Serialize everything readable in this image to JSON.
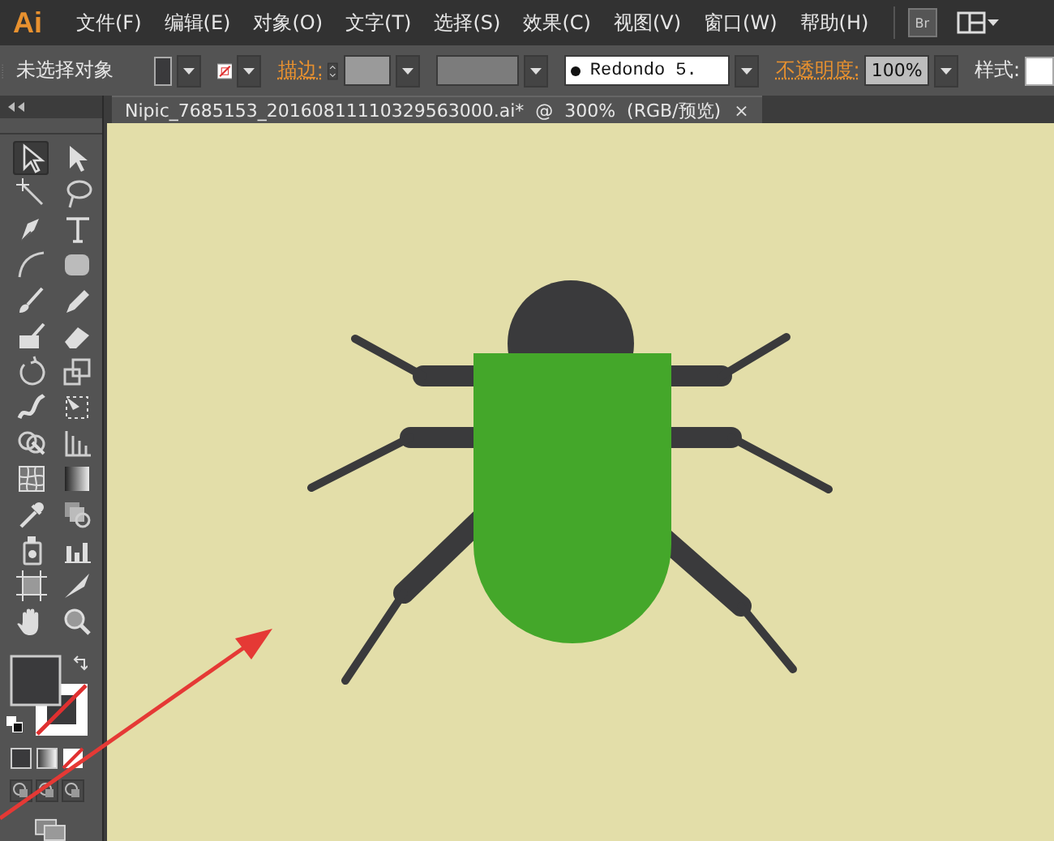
{
  "app": {
    "logo": "Ai"
  },
  "menu": [
    {
      "label": "文件(F)"
    },
    {
      "label": "编辑(E)"
    },
    {
      "label": "对象(O)"
    },
    {
      "label": "文字(T)"
    },
    {
      "label": "选择(S)"
    },
    {
      "label": "效果(C)"
    },
    {
      "label": "视图(V)"
    },
    {
      "label": "窗口(W)"
    },
    {
      "label": "帮助(H)"
    }
  ],
  "bridge_button": {
    "label": "Br"
  },
  "control_bar": {
    "selection_label": "未选择对象",
    "stroke_label": "描边:",
    "brush": "Redondo 5.",
    "opacity_label": "不透明度:",
    "opacity": "100%",
    "style_label": "样式:"
  },
  "document_tab": {
    "title": "Nipic_7685153_20160811110329563000.ai*  @  300%  (RGB/预览)",
    "close": "×"
  },
  "tools": [
    {
      "kind": "selection",
      "selected": true
    },
    {
      "kind": "direct-selection",
      "selected": false
    },
    {
      "kind": "magic-wand",
      "selected": false
    },
    {
      "kind": "lasso",
      "selected": false
    },
    {
      "kind": "pen",
      "selected": false
    },
    {
      "kind": "type",
      "selected": false
    },
    {
      "kind": "arc",
      "selected": false
    },
    {
      "kind": "rounded-rect",
      "selected": false
    },
    {
      "kind": "paintbrush",
      "selected": false
    },
    {
      "kind": "pencil",
      "selected": false
    },
    {
      "kind": "blob-brush",
      "selected": false
    },
    {
      "kind": "eraser",
      "selected": false
    },
    {
      "kind": "rotate",
      "selected": false
    },
    {
      "kind": "scale",
      "selected": false
    },
    {
      "kind": "warp",
      "selected": false
    },
    {
      "kind": "free-transform",
      "selected": false
    },
    {
      "kind": "shape-builder",
      "selected": false
    },
    {
      "kind": "graph",
      "selected": false
    },
    {
      "kind": "mesh",
      "selected": false
    },
    {
      "kind": "gradient",
      "selected": false
    },
    {
      "kind": "eyedropper",
      "selected": false
    },
    {
      "kind": "blend",
      "selected": false
    },
    {
      "kind": "symbol-sprayer",
      "selected": false
    },
    {
      "kind": "column-graph",
      "selected": false
    },
    {
      "kind": "artboard",
      "selected": false
    },
    {
      "kind": "slice",
      "selected": false
    },
    {
      "kind": "hand",
      "selected": false
    },
    {
      "kind": "zoom",
      "selected": false
    }
  ]
}
